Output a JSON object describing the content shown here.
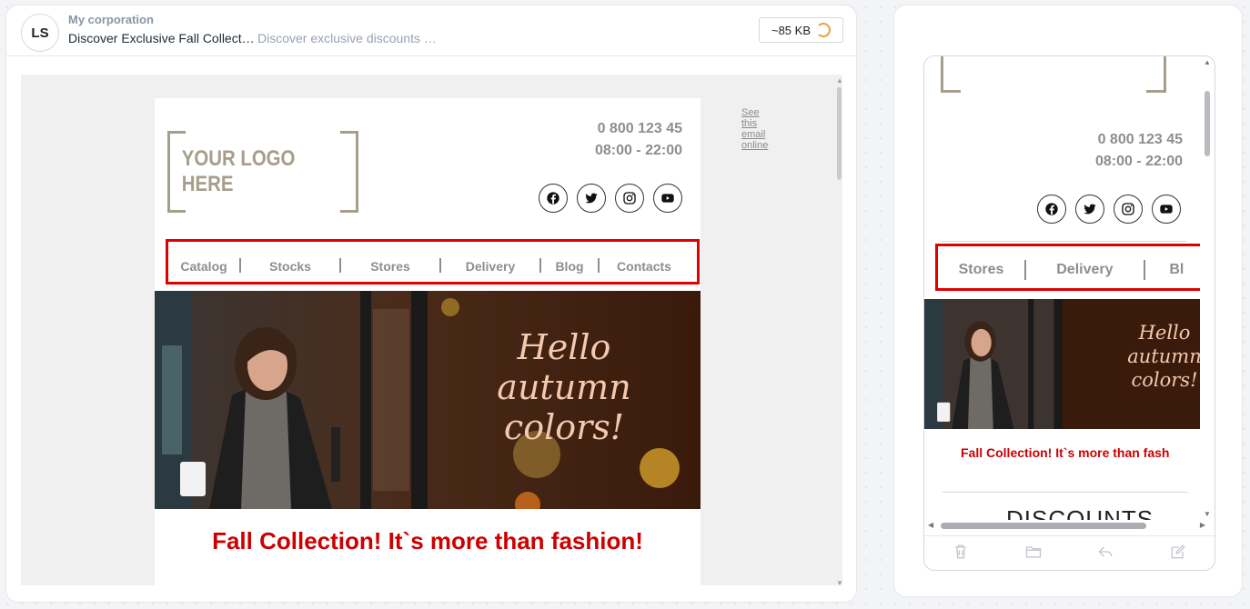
{
  "header": {
    "avatar_initials": "LS",
    "sender": "My corporation",
    "subject": "Discover Exclusive Fall Collect…",
    "preheader": "Discover exclusive discounts …",
    "size": "~85 KB"
  },
  "email": {
    "see_online": "See this email online",
    "logo_text": "YOUR LOGO HERE",
    "phone": "0 800 123 45",
    "hours": "08:00 - 22:00",
    "socials": [
      "facebook-icon",
      "twitter-icon",
      "instagram-icon",
      "youtube-icon"
    ],
    "menu": [
      "Catalog",
      "Stocks",
      "Stores",
      "Delivery",
      "Blog",
      "Contacts"
    ],
    "hero": {
      "line1": "Hello",
      "line2": "autumn",
      "line3": "colors!"
    },
    "headline": "Fall Collection! It`s more than fashion!"
  },
  "mobile": {
    "phone": "0 800 123 45",
    "hours": "08:00 - 22:00",
    "menu": [
      "Stores",
      "Delivery",
      "Bl"
    ],
    "hero": {
      "line1": "Hello",
      "line2": "autumn",
      "line3": "colors!"
    },
    "headline": "Fall Collection! It`s more than fash",
    "discounts": "DISCOUNTS",
    "toolbar": [
      "trash-icon",
      "folder-icon",
      "reply-icon",
      "compose-icon"
    ]
  },
  "colors": {
    "accent_red": "#cc0000",
    "highlight_border": "#e00000",
    "logo_gold": "#a59e8b",
    "muted_text": "#8e8e8e"
  }
}
